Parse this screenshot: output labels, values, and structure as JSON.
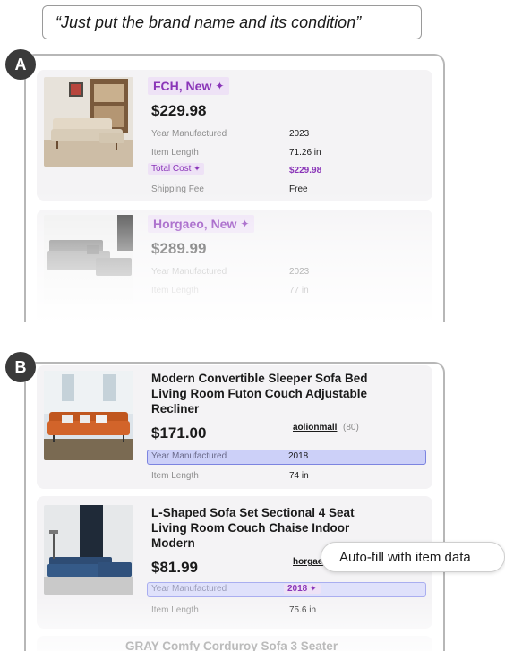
{
  "prompt": "“Just put the brand name and its condition”",
  "section_a": {
    "badge": "A",
    "cards": [
      {
        "title": "FCH, New",
        "price": "$229.98",
        "rows": [
          {
            "label": "Year Manufactured",
            "value": "2023"
          },
          {
            "label": "Item Length",
            "value": "71.26 in"
          }
        ],
        "total_cost_label": "Total Cost",
        "total_cost_value": "$229.98",
        "shipping_label": "Shipping Fee",
        "shipping_value": "Free"
      },
      {
        "title": "Horgaeo, New",
        "price": "$289.99",
        "rows": [
          {
            "label": "Year Manufactured",
            "value": "2023"
          },
          {
            "label": "Item Length",
            "value": "77 in"
          }
        ]
      }
    ]
  },
  "section_b": {
    "badge": "B",
    "cards": [
      {
        "title": "Modern Convertible Sleeper Sofa Bed Living Room Futon Couch Adjustable Recliner",
        "price": "$171.00",
        "seller": "aolionmall",
        "seller_count": "(80)",
        "highlight_label": "Year Manufactured",
        "highlight_value": "2018",
        "row_label": "Item Length",
        "row_value": "74 in"
      },
      {
        "title": "L-Shaped Sofa Set Sectional 4 Seat Living Room Couch Chaise Indoor Modern",
        "price": "$81.99",
        "seller": "horgaeo",
        "highlight_label": "Year Manufactured",
        "highlight_value": "2018",
        "row_label": "Item Length",
        "row_value": "75.6 in"
      }
    ],
    "next_title_partial": "GRAY Comfy Corduroy Sofa 3 Seater"
  },
  "tooltip": "Auto-fill with item data",
  "sparkle_icon": "✦",
  "colors": {
    "accent_purple": "#8a35b8",
    "tag_bg": "#eee2f6",
    "highlight_bg": "#ccd0f8",
    "highlight_border": "#7c84e0"
  }
}
